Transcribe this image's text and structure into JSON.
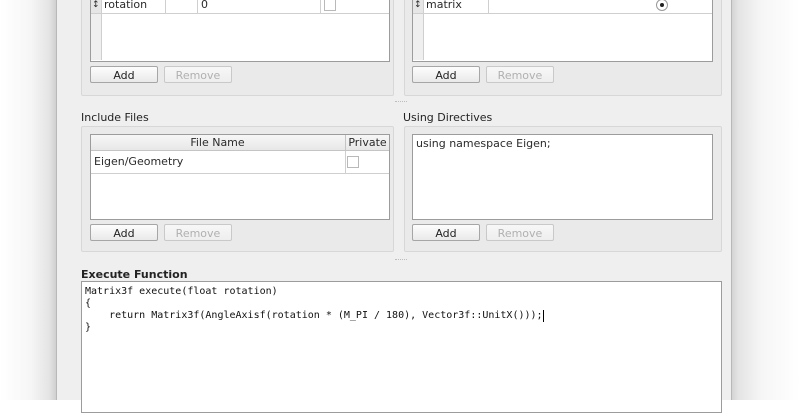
{
  "parameters": {
    "rows": [
      {
        "name": "rotation",
        "default": "0"
      }
    ],
    "add_label": "Add",
    "remove_label": "Remove"
  },
  "returns": {
    "rows": [
      {
        "name": "matrix"
      }
    ],
    "add_label": "Add",
    "remove_label": "Remove"
  },
  "include_files": {
    "title": "Include Files",
    "columns": [
      "File Name",
      "Private"
    ],
    "rows": [
      {
        "file_name": "Eigen/Geometry"
      }
    ],
    "add_label": "Add",
    "remove_label": "Remove"
  },
  "using_directives": {
    "title": "Using Directives",
    "text": "using namespace Eigen;",
    "add_label": "Add",
    "remove_label": "Remove"
  },
  "execute_function": {
    "title": "Execute Function",
    "lines": [
      "Matrix3f execute(float rotation)",
      "{",
      "    return Matrix3f(AngleAxisf(rotation * (M_PI / 180), Vector3f::UnitX()));",
      "}"
    ]
  }
}
